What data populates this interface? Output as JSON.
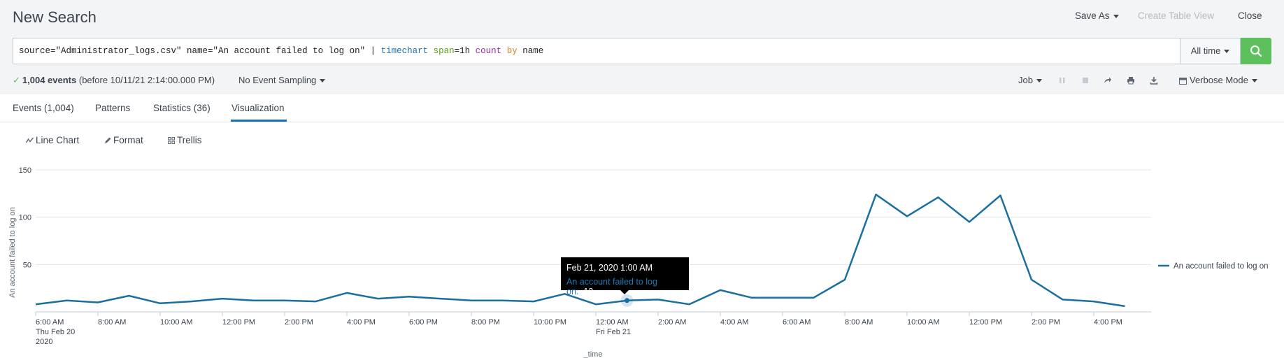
{
  "header": {
    "title": "New Search",
    "save_as": "Save As",
    "create_table_view": "Create Table View",
    "close": "Close"
  },
  "search": {
    "q1": "source=\"Administrator_logs.csv\" name=\"An account failed to log on\" | ",
    "q_timechart": "timechart",
    "q_span": "span",
    "q_span_val": "=1h ",
    "q_count": "count",
    "q_by": "by",
    "q_name": " name",
    "time_range": "All time"
  },
  "status": {
    "events_count": "1,004 events",
    "events_before": "(before 10/11/21 2:14:00.000 PM)",
    "sampling": "No Event Sampling",
    "job": "Job",
    "mode": "Verbose Mode"
  },
  "tabs": [
    "Events (1,004)",
    "Patterns",
    "Statistics (36)",
    "Visualization"
  ],
  "viz_toolbar": {
    "line_chart": "Line Chart",
    "format": "Format",
    "trellis": "Trellis"
  },
  "tooltip": {
    "time": "Feb 21, 2020 1:00 AM",
    "series": "An account failed to log on:",
    "value": "12"
  },
  "chart_data": {
    "type": "line",
    "xlabel": "_time",
    "ylabel": "An account failed to log on",
    "ylim": [
      0,
      150
    ],
    "yticks": [
      50,
      100,
      150
    ],
    "legend": "right",
    "series": [
      {
        "name": "An account failed to log on",
        "color": "#1a6fa0",
        "x": [
          "2020-02-20 06:00",
          "2020-02-20 07:00",
          "2020-02-20 08:00",
          "2020-02-20 09:00",
          "2020-02-20 10:00",
          "2020-02-20 11:00",
          "2020-02-20 12:00",
          "2020-02-20 13:00",
          "2020-02-20 14:00",
          "2020-02-20 15:00",
          "2020-02-20 16:00",
          "2020-02-20 17:00",
          "2020-02-20 18:00",
          "2020-02-20 19:00",
          "2020-02-20 20:00",
          "2020-02-20 21:00",
          "2020-02-20 22:00",
          "2020-02-20 23:00",
          "2020-02-21 00:00",
          "2020-02-21 01:00",
          "2020-02-21 02:00",
          "2020-02-21 03:00",
          "2020-02-21 04:00",
          "2020-02-21 05:00",
          "2020-02-21 06:00",
          "2020-02-21 07:00",
          "2020-02-21 08:00",
          "2020-02-21 09:00",
          "2020-02-21 10:00",
          "2020-02-21 11:00",
          "2020-02-21 12:00",
          "2020-02-21 13:00",
          "2020-02-21 14:00",
          "2020-02-21 15:00",
          "2020-02-21 16:00",
          "2020-02-21 17:00"
        ],
        "values": [
          8,
          12,
          10,
          17,
          9,
          11,
          14,
          12,
          12,
          11,
          20,
          14,
          16,
          14,
          12,
          12,
          11,
          19,
          8,
          12,
          13,
          8,
          23,
          15,
          15,
          15,
          34,
          124,
          101,
          121,
          95,
          123,
          34,
          13,
          11,
          6
        ]
      }
    ],
    "x_ticks": [
      {
        "line1": "6:00 AM",
        "line2": "Thu Feb 20",
        "line3": "2020"
      },
      {
        "line1": "8:00 AM"
      },
      {
        "line1": "10:00 AM"
      },
      {
        "line1": "12:00 PM"
      },
      {
        "line1": "2:00 PM"
      },
      {
        "line1": "4:00 PM"
      },
      {
        "line1": "6:00 PM"
      },
      {
        "line1": "8:00 PM"
      },
      {
        "line1": "10:00 PM"
      },
      {
        "line1": "12:00 AM",
        "line2": "Fri Feb 21"
      },
      {
        "line1": "2:00 AM"
      },
      {
        "line1": "4:00 AM"
      },
      {
        "line1": "6:00 AM"
      },
      {
        "line1": "8:00 AM"
      },
      {
        "line1": "10:00 AM"
      },
      {
        "line1": "12:00 PM"
      },
      {
        "line1": "2:00 PM"
      },
      {
        "line1": "4:00 PM"
      }
    ],
    "highlight_index": 19
  }
}
